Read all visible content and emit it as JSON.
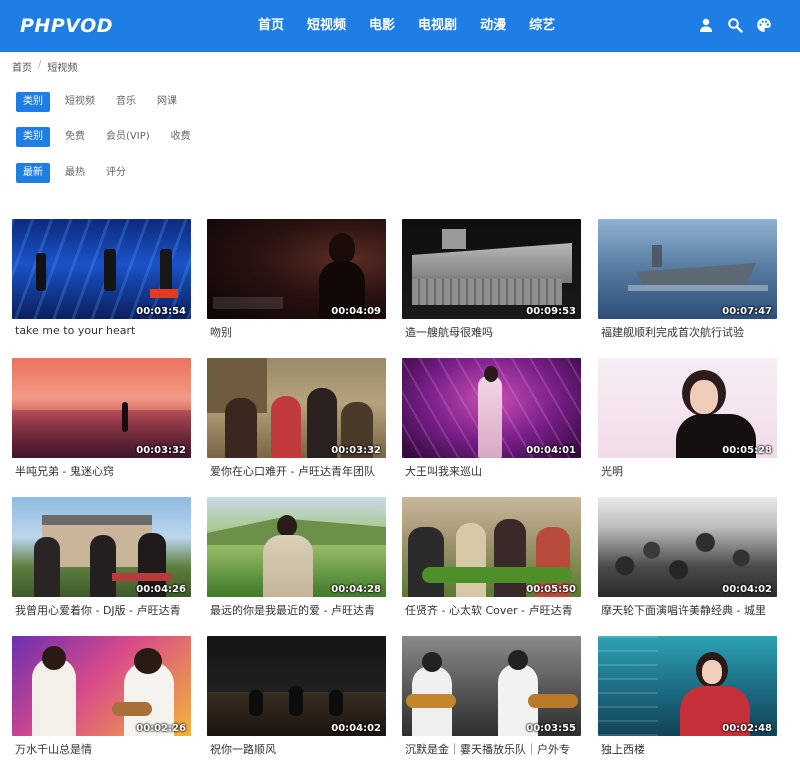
{
  "header": {
    "logo": "PHPVOD",
    "nav": [
      "首页",
      "短视频",
      "电影",
      "电视剧",
      "动漫",
      "综艺"
    ],
    "icons": [
      "user-icon",
      "search-icon",
      "palette-icon"
    ],
    "accent": "#1e7ee4"
  },
  "breadcrumb": {
    "home": "首页",
    "sep": "/",
    "current": "短视频"
  },
  "filters": [
    {
      "active": "类别",
      "options": [
        "短视频",
        "音乐",
        "网课"
      ]
    },
    {
      "active": "类别",
      "options": [
        "免费",
        "会员(VIP)",
        "收费"
      ]
    },
    {
      "active": "最新",
      "options": [
        "最热",
        "评分"
      ]
    }
  ],
  "videos": [
    {
      "title": "take me to your heart",
      "duration": "00:03:54"
    },
    {
      "title": "吻别",
      "duration": "00:04:09"
    },
    {
      "title": "造一艘航母很难吗",
      "duration": "00:09:53"
    },
    {
      "title": "福建舰顺利完成首次航行试验",
      "duration": "00:07:47"
    },
    {
      "title": "半吨兄弟 - 鬼迷心窍",
      "duration": "00:03:32"
    },
    {
      "title": "爱你在心口难开 - 卢旺达青年团队",
      "duration": "00:03:32"
    },
    {
      "title": "大王叫我来巡山",
      "duration": "00:04:01"
    },
    {
      "title": "光明",
      "duration": "00:05:28"
    },
    {
      "title": "我曾用心爱着你 - DJ版 - 卢旺达青",
      "duration": "00:04:26"
    },
    {
      "title": "最远的你是我最近的爱 - 卢旺达青",
      "duration": "00:04:28"
    },
    {
      "title": "任贤齐 - 心太软 Cover - 卢旺达青",
      "duration": "00:05:50"
    },
    {
      "title": "摩天轮下面演唱许美静经典 - 城里",
      "duration": "00:04:02"
    },
    {
      "title": "万水千山总是情",
      "duration": "00:02:26"
    },
    {
      "title": "祝你一路顺风",
      "duration": "00:04:02"
    },
    {
      "title": "沉默是金｜霎天播放乐队｜户外专",
      "duration": "00:03:55"
    },
    {
      "title": "独上西楼",
      "duration": "00:02:48"
    }
  ]
}
